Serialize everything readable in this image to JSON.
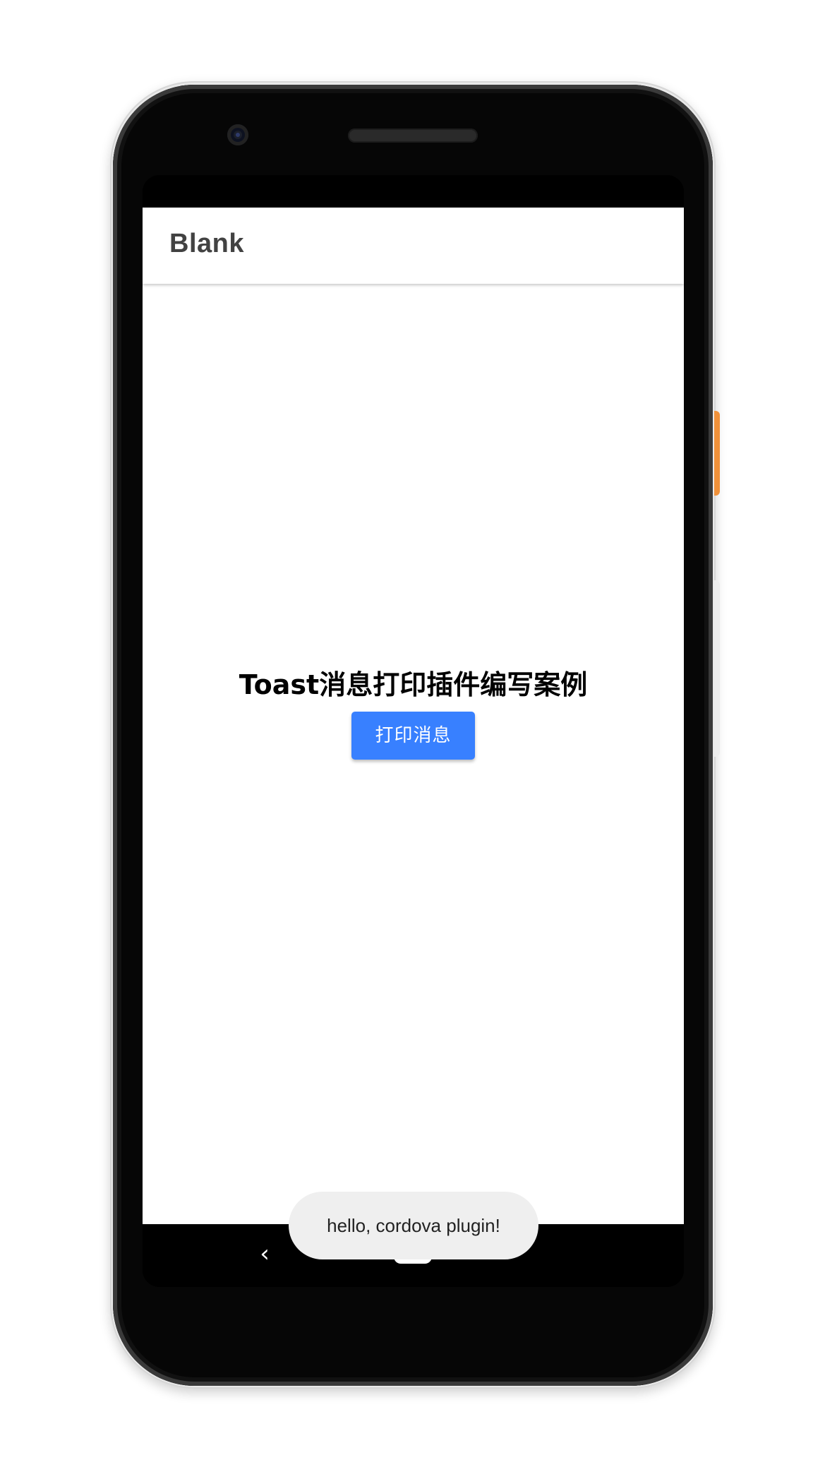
{
  "app": {
    "title": "Blank"
  },
  "main": {
    "heading": "Toast消息打印插件编写案例",
    "print_button_label": "打印消息"
  },
  "toast": {
    "message": "hello, cordova plugin!"
  },
  "nav": {
    "back_icon": "chevron-left-icon",
    "back_glyph": "‹",
    "home_icon": "home-pill-icon"
  },
  "colors": {
    "accent": "#3880ff",
    "power_button": "#f0913a",
    "toast_bg": "#efefef"
  }
}
